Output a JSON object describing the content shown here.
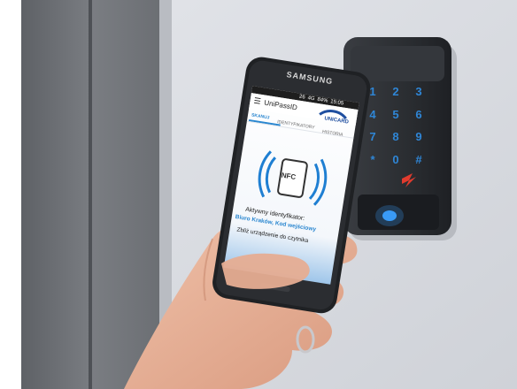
{
  "phone": {
    "brand": "SAMSUNG",
    "app_title": "UniPassID",
    "status_bar": {
      "signal": "26",
      "network": "4G",
      "battery": "84%",
      "time": "15:05"
    },
    "logo_text": "UNICARD",
    "tabs": [
      {
        "label": "SKANUJ"
      },
      {
        "label": "IDENTYFIKATORY"
      },
      {
        "label": "HISTORIA"
      }
    ],
    "nfc_label": "NFC",
    "active_id_heading": "Aktywny identyfikator:",
    "active_id_value": "Biuro Kraków, Kod wejściowy",
    "instruction": "Zbliż urządzenie do czytnika"
  },
  "keypad": {
    "keys": [
      "1",
      "2",
      "3",
      "4",
      "5",
      "6",
      "7",
      "8",
      "9",
      "*",
      "0",
      "#"
    ]
  },
  "colors": {
    "wall": "#d6d9df",
    "door_panel": "#6f7277",
    "reader_body": "#2e3136",
    "key_digit": "#2f86d6",
    "app_blue": "#2a87d0",
    "nfc_blue": "#1f7fd2",
    "skin": "#e9b39a"
  }
}
